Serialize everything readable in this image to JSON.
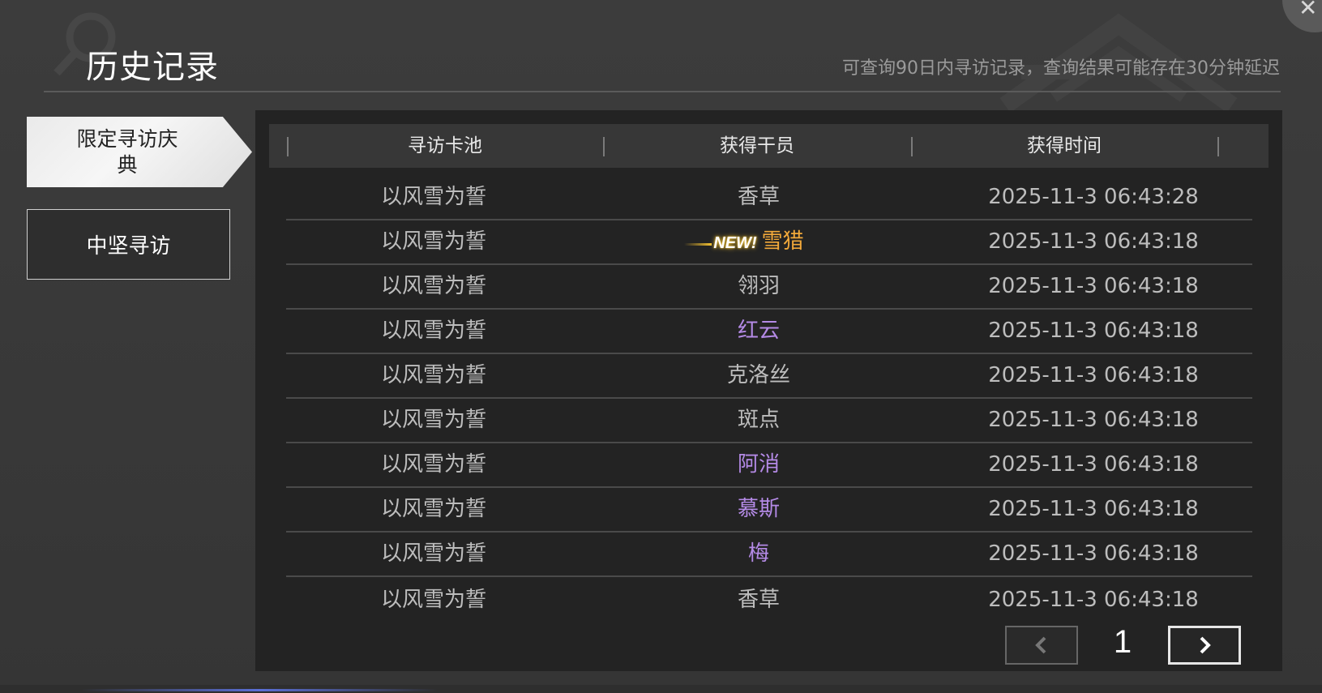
{
  "header": {
    "title": "历史记录",
    "notice": "可查询90日内寻访记录，查询结果可能存在30分钟延迟",
    "close_icon": "close-icon"
  },
  "sidebar": {
    "tabs": [
      {
        "label": "限定寻访庆典",
        "active": true
      },
      {
        "label": "中坚寻访",
        "active": false
      }
    ]
  },
  "table": {
    "columns": [
      "寻访卡池",
      "获得干员",
      "获得时间"
    ],
    "rows": [
      {
        "pool": "以风雪为誓",
        "operator": "香草",
        "time": "2025-11-3 06:43:28",
        "rarity": "normal",
        "new": false
      },
      {
        "pool": "以风雪为誓",
        "operator": "雪猎",
        "time": "2025-11-3 06:43:18",
        "rarity": "gold",
        "new": true
      },
      {
        "pool": "以风雪为誓",
        "operator": "翎羽",
        "time": "2025-11-3 06:43:18",
        "rarity": "normal",
        "new": false
      },
      {
        "pool": "以风雪为誓",
        "operator": "红云",
        "time": "2025-11-3 06:43:18",
        "rarity": "purple",
        "new": false
      },
      {
        "pool": "以风雪为誓",
        "operator": "克洛丝",
        "time": "2025-11-3 06:43:18",
        "rarity": "normal",
        "new": false
      },
      {
        "pool": "以风雪为誓",
        "operator": "斑点",
        "time": "2025-11-3 06:43:18",
        "rarity": "normal",
        "new": false
      },
      {
        "pool": "以风雪为誓",
        "operator": "阿消",
        "time": "2025-11-3 06:43:18",
        "rarity": "purple",
        "new": false
      },
      {
        "pool": "以风雪为誓",
        "operator": "慕斯",
        "time": "2025-11-3 06:43:18",
        "rarity": "purple",
        "new": false
      },
      {
        "pool": "以风雪为誓",
        "operator": "梅",
        "time": "2025-11-3 06:43:18",
        "rarity": "purple",
        "new": false
      },
      {
        "pool": "以风雪为誓",
        "operator": "香草",
        "time": "2025-11-3 06:43:18",
        "rarity": "normal",
        "new": false
      }
    ],
    "new_badge": "NEW!"
  },
  "pagination": {
    "page": "1",
    "prev_icon": "chevron-left-icon",
    "next_icon": "chevron-right-icon"
  },
  "colors": {
    "gold": "#f2a93a",
    "purple": "#b48ae6",
    "normal": "#bdbdbd"
  }
}
